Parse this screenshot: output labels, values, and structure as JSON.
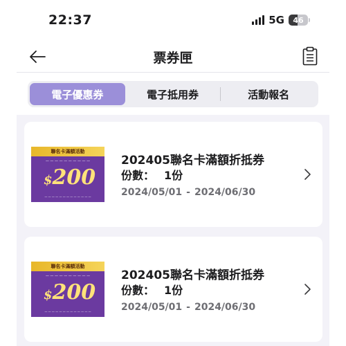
{
  "status_bar": {
    "time": "22:37",
    "network": "5G",
    "battery_level": "46"
  },
  "nav": {
    "title": "票券匣",
    "back_icon": "arrow-left-icon",
    "right_icon": "clipboard-list-icon"
  },
  "tabs": [
    {
      "label": "電子優惠券",
      "active": true
    },
    {
      "label": "電子抵用券",
      "active": false
    },
    {
      "label": "活動報名",
      "active": false
    }
  ],
  "colors": {
    "accent": "#9b8fd9",
    "coupon_purple": "#6b3aa0",
    "coupon_gold": "#f5d45a"
  },
  "coupons": [
    {
      "image": {
        "band_text": "聯名卡滿額活動",
        "currency": "$",
        "amount": "200"
      },
      "title": "202405聯名卡滿額折抵券",
      "qty_label": "份數：",
      "qty_value": "1份",
      "date_start": "2024/05/01",
      "date_separator": "-",
      "date_end": "2024/06/30"
    },
    {
      "image": {
        "band_text": "聯名卡滿額活動",
        "currency": "$",
        "amount": "200"
      },
      "title": "202405聯名卡滿額折抵券",
      "qty_label": "份數：",
      "qty_value": "1份",
      "date_start": "2024/05/01",
      "date_separator": "-",
      "date_end": "2024/06/30"
    }
  ]
}
